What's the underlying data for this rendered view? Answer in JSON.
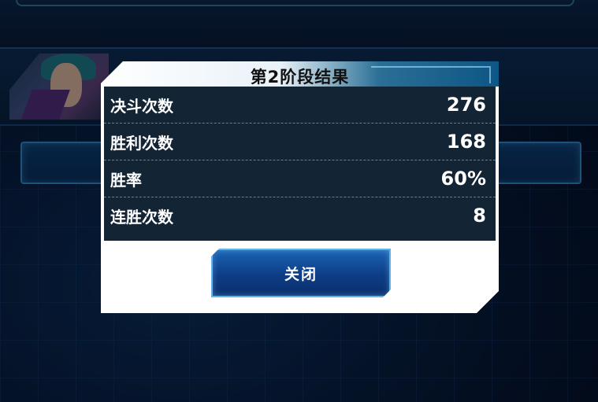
{
  "dialog": {
    "title": "第2阶段结果",
    "stats": [
      {
        "label": "决斗次数",
        "value": "276"
      },
      {
        "label": "胜利次数",
        "value": "168"
      },
      {
        "label": "胜率",
        "value": "60%"
      },
      {
        "label": "连胜次数",
        "value": "8"
      }
    ],
    "close_label": "关闭"
  },
  "colors": {
    "background": "#06172f",
    "stats_panel": "#132435",
    "button": "#0e3d86",
    "button_border": "#5fb3ea"
  }
}
